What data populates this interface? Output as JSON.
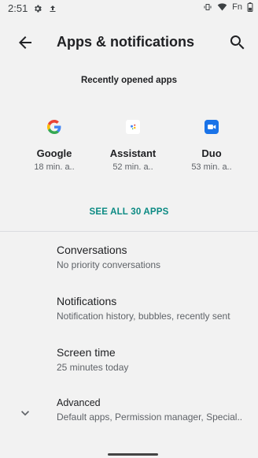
{
  "status_bar": {
    "time": "2:51",
    "fn": "Fn"
  },
  "app_bar": {
    "title": "Apps & notifications"
  },
  "recent": {
    "header": "Recently opened apps",
    "apps": [
      {
        "name": "Google",
        "time": "18 min. a.."
      },
      {
        "name": "Assistant",
        "time": "52 min. a.."
      },
      {
        "name": "Duo",
        "time": "53 min. a.."
      }
    ],
    "see_all": "SEE ALL 30 APPS"
  },
  "items": [
    {
      "title": "Conversations",
      "subtitle": "No priority conversations"
    },
    {
      "title": "Notifications",
      "subtitle": "Notification history, bubbles, recently sent"
    },
    {
      "title": "Screen time",
      "subtitle": "25 minutes today"
    },
    {
      "title": "Advanced",
      "subtitle": "Default apps, Permission manager, Special.."
    }
  ],
  "colors": {
    "accent": "#0b8a83",
    "duo_blue": "#1a73e8"
  }
}
